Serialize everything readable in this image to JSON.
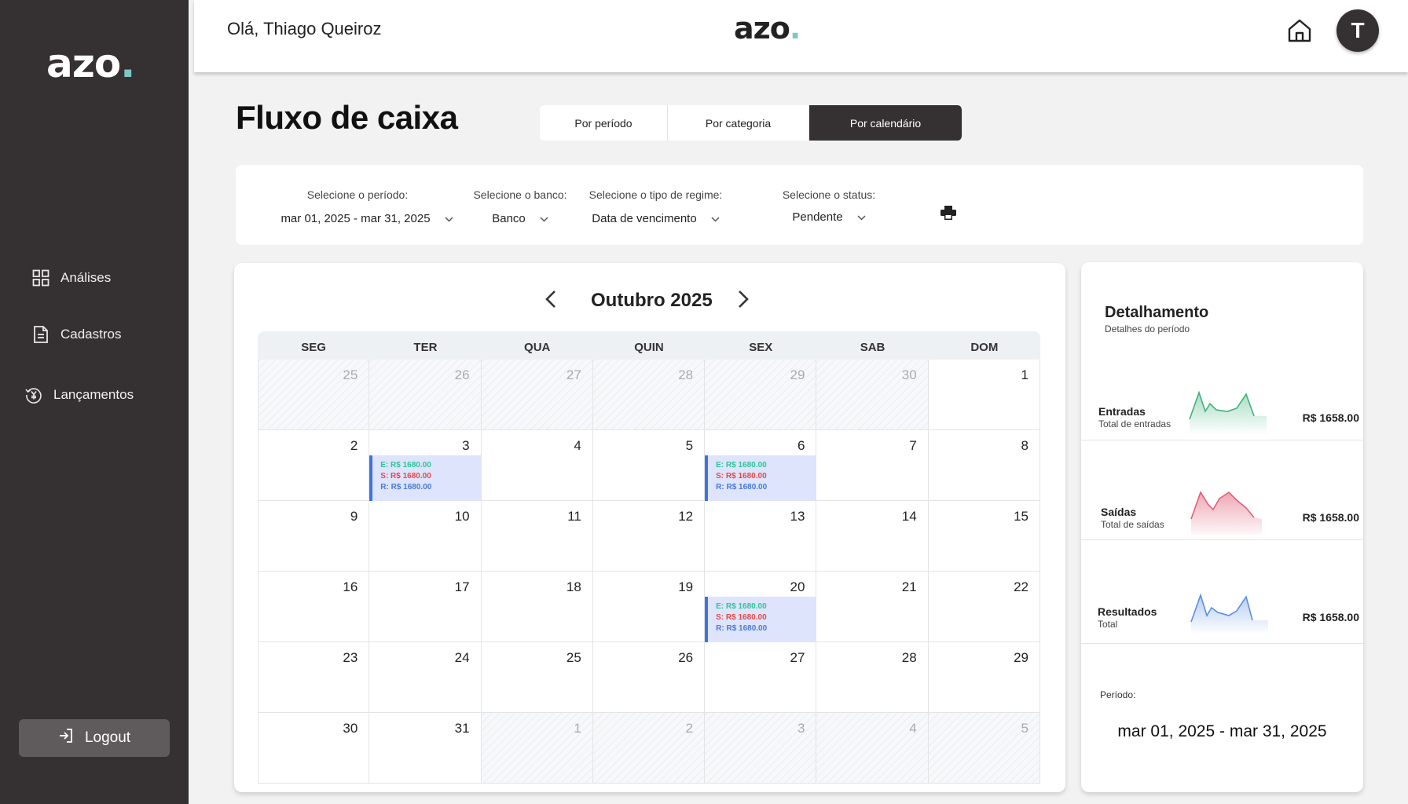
{
  "sidebar": {
    "logo": "azo",
    "logo_dot": ".",
    "items": [
      {
        "label": "Análises",
        "icon": "grid-icon"
      },
      {
        "label": "Cadastros",
        "icon": "document-icon"
      },
      {
        "label": "Lançamentos",
        "icon": "currency-icon"
      }
    ],
    "logout_label": "Logout"
  },
  "header": {
    "greeting": "Olá, Thiago Queiroz",
    "logo": "azo",
    "logo_dot": ".",
    "avatar_initial": "T"
  },
  "page": {
    "title": "Fluxo de caixa",
    "tabs": [
      {
        "label": "Por período",
        "active": false
      },
      {
        "label": "Por categoria",
        "active": false
      },
      {
        "label": "Por calendário",
        "active": true
      }
    ]
  },
  "filters": {
    "period": {
      "label": "Selecione o período:",
      "value": "mar 01, 2025 - mar 31, 2025"
    },
    "bank": {
      "label": "Selecione o banco:",
      "value": "Banco"
    },
    "regime": {
      "label": "Selecione o tipo de regime:",
      "value": "Data de vencimento"
    },
    "status": {
      "label": "Selecione o status:",
      "value": "Pendente"
    }
  },
  "calendar": {
    "month": "Outubro 2025",
    "weekdays": [
      "SEG",
      "TER",
      "QUA",
      "QUIN",
      "SEX",
      "SAB",
      "DOM"
    ],
    "days": [
      {
        "n": "25",
        "muted": true
      },
      {
        "n": "26",
        "muted": true
      },
      {
        "n": "27",
        "muted": true
      },
      {
        "n": "28",
        "muted": true
      },
      {
        "n": "29",
        "muted": true
      },
      {
        "n": "30",
        "muted": true
      },
      {
        "n": "1"
      },
      {
        "n": "2"
      },
      {
        "n": "3",
        "event": {
          "e": "E: R$ 1680.00",
          "s": "S: R$ 1680.00",
          "r": "R: R$ 1680.00"
        }
      },
      {
        "n": "4"
      },
      {
        "n": "5"
      },
      {
        "n": "6",
        "event": {
          "e": "E: R$ 1680.00",
          "s": "S: R$ 1680.00",
          "r": "R: R$ 1680.00"
        }
      },
      {
        "n": "7"
      },
      {
        "n": "8"
      },
      {
        "n": "9"
      },
      {
        "n": "10"
      },
      {
        "n": "11"
      },
      {
        "n": "12"
      },
      {
        "n": "13"
      },
      {
        "n": "14"
      },
      {
        "n": "15"
      },
      {
        "n": "16"
      },
      {
        "n": "17"
      },
      {
        "n": "18"
      },
      {
        "n": "19"
      },
      {
        "n": "20",
        "event": {
          "e": "E: R$ 1680.00",
          "s": "S: R$ 1680.00",
          "r": "R: R$ 1680.00"
        }
      },
      {
        "n": "21"
      },
      {
        "n": "22"
      },
      {
        "n": "23"
      },
      {
        "n": "24"
      },
      {
        "n": "25"
      },
      {
        "n": "26"
      },
      {
        "n": "27"
      },
      {
        "n": "28"
      },
      {
        "n": "29"
      },
      {
        "n": "30"
      },
      {
        "n": "31"
      },
      {
        "n": "1",
        "muted": true
      },
      {
        "n": "2",
        "muted": true
      },
      {
        "n": "3",
        "muted": true
      },
      {
        "n": "4",
        "muted": true
      },
      {
        "n": "5",
        "muted": true
      }
    ]
  },
  "detail": {
    "title": "Detalhamento",
    "subtitle": "Detalhes do período",
    "metrics": [
      {
        "title": "Entradas",
        "subtitle": "Total de entradas",
        "value": "R$ 1658.00",
        "color": "#3fb27a"
      },
      {
        "title": "Saídas",
        "subtitle": "Total de saídas",
        "value": "R$ 1658.00",
        "color": "#e0607a"
      },
      {
        "title": "Resultados",
        "subtitle": "Total",
        "value": "R$ 1658.00",
        "color": "#5a8fe0"
      }
    ],
    "period_label": "Período:",
    "period_value": "mar 01, 2025 - mar 31, 2025"
  },
  "colors": {
    "sidebar_bg": "#353032",
    "accent_dot": "#7ec8c4",
    "event_bg": "#dde4fb",
    "event_border": "#3c73e6",
    "entrada": "#2ec59a",
    "saida": "#e64848",
    "resultado": "#4a7ad8"
  }
}
